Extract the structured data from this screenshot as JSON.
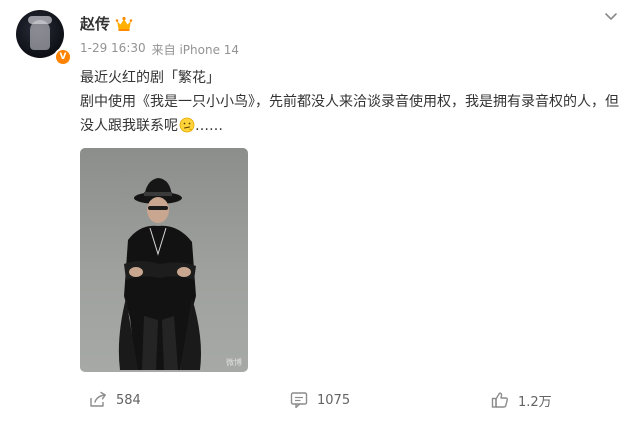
{
  "user": {
    "name": "赵传",
    "verified_badge": "V"
  },
  "post": {
    "time": "1-29 16:30",
    "source": "来自 iPhone 14",
    "line1": "最近火红的剧「繁花」",
    "line2_prefix": "剧中使用",
    "song_title": "《我是一只小小鸟》",
    "line2_suffix": "，先前都没人来洽谈录音使用权，我是拥有录音权的人，但没人跟我联系呢",
    "ellipsis": "……"
  },
  "image": {
    "watermark": "微博"
  },
  "actions": {
    "repost_count": "584",
    "comment_count": "1075",
    "like_count": "1.2万"
  },
  "icons": {
    "menu": "chevron-down-icon",
    "crown": "crown-icon",
    "emoji": "thinking-face-icon",
    "repost": "share-icon",
    "comment": "comment-icon",
    "like": "thumbs-up-icon"
  },
  "colors": {
    "verified": "#ff8200",
    "meta_text": "#939393",
    "body_text": "#333333",
    "action_text": "#636363"
  }
}
